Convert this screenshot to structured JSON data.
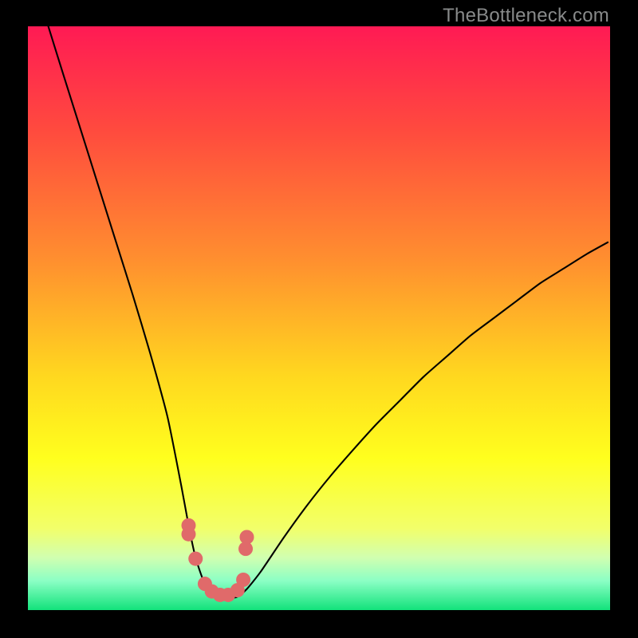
{
  "watermark": "TheBottleneck.com",
  "chart_data": {
    "type": "line",
    "title": "",
    "xlabel": "",
    "ylabel": "",
    "xlim": [
      0,
      100
    ],
    "ylim": [
      0,
      100
    ],
    "grid": false,
    "legend": false,
    "gradient_stops": [
      {
        "offset": 0,
        "color": "#ff1a54"
      },
      {
        "offset": 18,
        "color": "#ff4b3e"
      },
      {
        "offset": 40,
        "color": "#ff8f2f"
      },
      {
        "offset": 60,
        "color": "#ffd81f"
      },
      {
        "offset": 74,
        "color": "#ffff1e"
      },
      {
        "offset": 86,
        "color": "#f2ff6a"
      },
      {
        "offset": 91,
        "color": "#d1ffb0"
      },
      {
        "offset": 95,
        "color": "#8bffc5"
      },
      {
        "offset": 100,
        "color": "#12e27b"
      }
    ],
    "series": [
      {
        "name": "bottleneck-curve",
        "x": [
          3.5,
          6,
          9,
          12,
          15,
          18,
          21,
          24,
          26.4,
          27.6,
          28.8,
          30.4,
          32.8,
          35.8,
          37.6,
          40,
          44,
          48,
          52,
          56,
          60,
          64,
          68,
          72,
          76,
          80,
          84,
          88,
          92,
          96,
          99.6
        ],
        "y": [
          100,
          92,
          82.5,
          73,
          63.5,
          54,
          44,
          33,
          21,
          14.5,
          9,
          4.5,
          2.2,
          2.2,
          3.6,
          6.6,
          12.5,
          18,
          23,
          27.6,
          32,
          36,
          40,
          43.5,
          47,
          50,
          53,
          56,
          58.5,
          61,
          63
        ]
      }
    ],
    "markers": [
      {
        "x": 27.6,
        "y": 14.5
      },
      {
        "x": 27.6,
        "y": 13.0
      },
      {
        "x": 28.8,
        "y": 8.8
      },
      {
        "x": 30.4,
        "y": 4.5
      },
      {
        "x": 31.6,
        "y": 3.2
      },
      {
        "x": 33.0,
        "y": 2.6
      },
      {
        "x": 34.4,
        "y": 2.6
      },
      {
        "x": 36.0,
        "y": 3.4
      },
      {
        "x": 37.0,
        "y": 5.2
      },
      {
        "x": 37.4,
        "y": 10.5
      },
      {
        "x": 37.6,
        "y": 12.5
      }
    ],
    "marker_style": {
      "color": "#e06a6a",
      "radius_px": 9
    }
  }
}
